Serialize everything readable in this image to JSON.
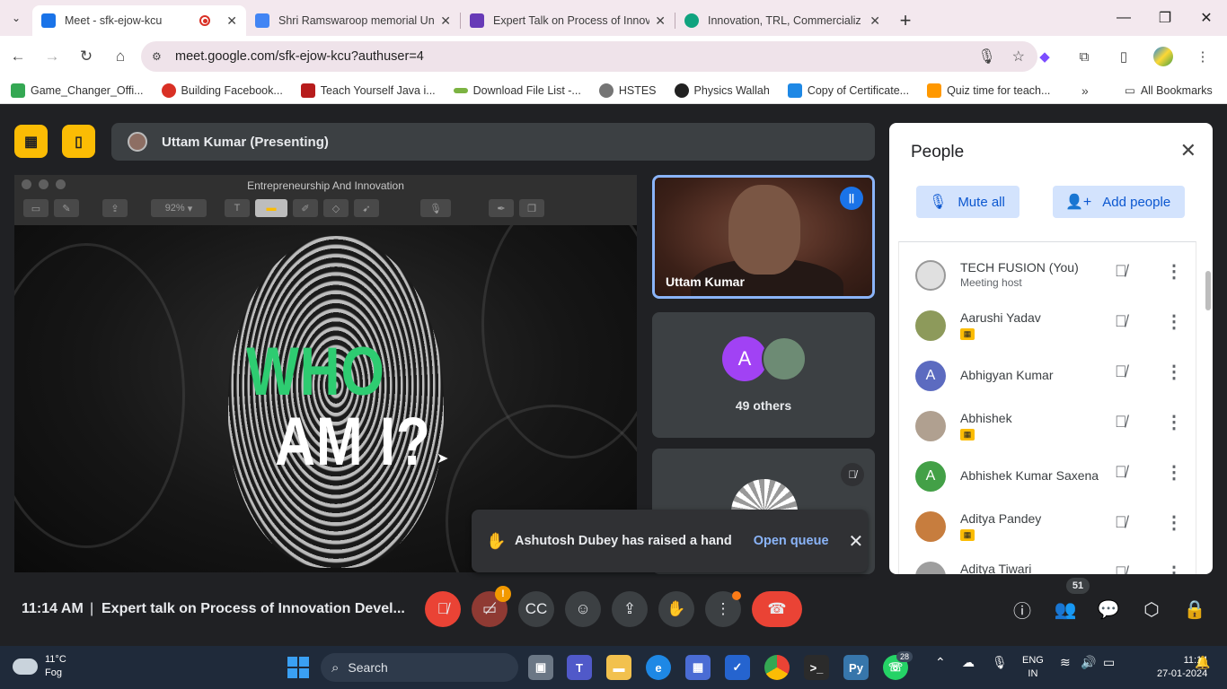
{
  "browser": {
    "tabs": [
      {
        "title": "Meet - sfk-ejow-kcu",
        "favicon_color": "#1a73e8",
        "recording": true,
        "active": true
      },
      {
        "title": "Shri Ramswaroop memorial Uni",
        "favicon_color": "#4285f4",
        "recording": false,
        "active": false
      },
      {
        "title": "Expert Talk on Process of Innov",
        "favicon_color": "#673ab7",
        "recording": false,
        "active": false
      },
      {
        "title": "Innovation, TRL, Commercializ",
        "favicon_color": "#10a37f",
        "recording": false,
        "active": false
      }
    ],
    "new_tab_label": "+",
    "url": "meet.google.com/sfk-ejow-kcu?authuser=4",
    "bookmarks": [
      {
        "label": "Game_Changer_Offi...",
        "color": "#34a853"
      },
      {
        "label": "Building Facebook...",
        "color": "#d93025"
      },
      {
        "label": "Teach Yourself Java i...",
        "color": "#b71c1c"
      },
      {
        "label": "Download File List -...",
        "color": "#7cb342"
      },
      {
        "label": "HSTES",
        "color": "#757575"
      },
      {
        "label": "Physics Wallah",
        "color": "#212121"
      },
      {
        "label": "Copy of Certificate...",
        "color": "#1e88e5"
      },
      {
        "label": "Quiz time for teach...",
        "color": "#ff9800"
      }
    ],
    "all_bookmarks_label": "All Bookmarks"
  },
  "meet": {
    "presenter_bar": "Uttam Kumar (Presenting)",
    "presentation": {
      "window_title": "Entrepreneurship And Innovation",
      "zoom": "92%",
      "slide_line1": "WHO",
      "slide_line2": "AM I?"
    },
    "speaker_tile": {
      "name": "Uttam Kumar"
    },
    "others_tile": {
      "avatar_letter": "A",
      "label": "49 others"
    },
    "toast": {
      "message": "Ashutosh Dubey has raised a hand",
      "action": "Open queue"
    },
    "people_panel": {
      "title": "People",
      "mute_all": "Mute all",
      "add_people": "Add people",
      "participants": [
        {
          "name": "TECH FUSION (You)",
          "sub": "Meeting host",
          "avatar": "",
          "color": "#e0e0e0",
          "badge": false
        },
        {
          "name": "Aarushi Yadav",
          "sub": "",
          "avatar": "",
          "color": "#8d9a5b",
          "badge": true
        },
        {
          "name": "Abhigyan Kumar",
          "sub": "",
          "avatar": "A",
          "color": "#5c6bc0",
          "badge": false
        },
        {
          "name": "Abhishek",
          "sub": "",
          "avatar": "",
          "color": "#b0a090",
          "badge": true
        },
        {
          "name": "Abhishek Kumar Saxena",
          "sub": "",
          "avatar": "A",
          "color": "#43a047",
          "badge": false
        },
        {
          "name": "Aditya Pandey",
          "sub": "",
          "avatar": "",
          "color": "#c77d3e",
          "badge": true
        },
        {
          "name": "Aditya Tiwari",
          "sub": "",
          "avatar": "",
          "color": "#9e9e9e",
          "badge": false
        }
      ]
    },
    "controls": {
      "time": "11:14 AM",
      "divider": "|",
      "meeting_title": "Expert talk on Process of Innovation Devel...",
      "camera_alert": "!",
      "participant_count": "51"
    }
  },
  "taskbar": {
    "temperature": "11°C",
    "weather": "Fog",
    "search_label": "Search",
    "whatsapp_badge": "28",
    "lang_line1": "ENG",
    "lang_line2": "IN",
    "time": "11:14",
    "date": "27-01-2024"
  }
}
